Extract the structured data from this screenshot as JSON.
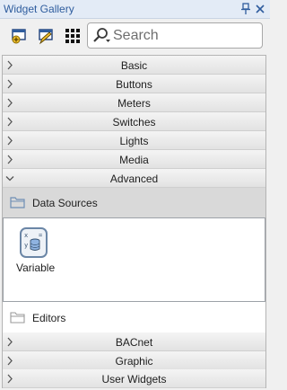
{
  "window": {
    "title": "Widget Gallery"
  },
  "toolbar": {
    "buttons": [
      {
        "icon": "add-widget-icon"
      },
      {
        "icon": "edit-widget-icon"
      },
      {
        "icon": "grid-view-icon"
      }
    ],
    "search": {
      "placeholder": "Search",
      "value": ""
    }
  },
  "categories_top": [
    {
      "label": "Basic",
      "expanded": false
    },
    {
      "label": "Buttons",
      "expanded": false
    },
    {
      "label": "Meters",
      "expanded": false
    },
    {
      "label": "Switches",
      "expanded": false
    },
    {
      "label": "Lights",
      "expanded": false
    },
    {
      "label": "Media",
      "expanded": false
    },
    {
      "label": "Advanced",
      "expanded": true
    }
  ],
  "advanced": {
    "data_sources": {
      "label": "Data Sources",
      "widgets": [
        {
          "label": "Variable",
          "icon": "variable-icon"
        }
      ]
    },
    "editors": {
      "label": "Editors"
    }
  },
  "categories_bottom": [
    {
      "label": "BACnet",
      "expanded": false
    },
    {
      "label": "Graphic",
      "expanded": false
    },
    {
      "label": "User Widgets",
      "expanded": false
    }
  ],
  "colors": {
    "title_text": "#2f5d9e",
    "title_bg": "#e3ebf6",
    "selected_bg": "#d9d9d9"
  }
}
